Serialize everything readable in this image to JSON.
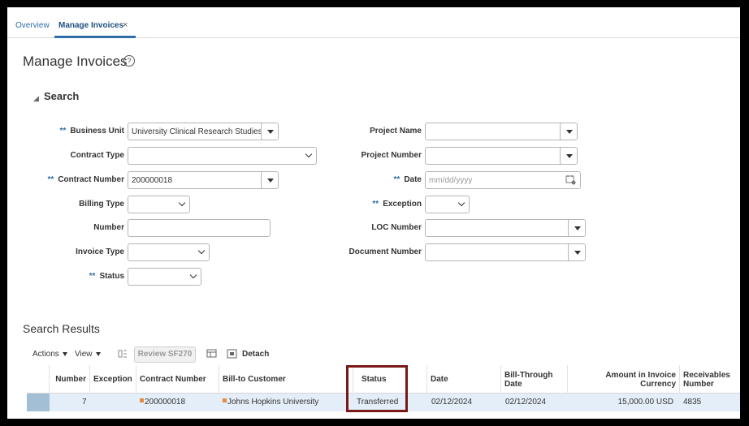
{
  "tabs": {
    "overview": "Overview",
    "manage": "Manage Invoices",
    "close": "×"
  },
  "page": {
    "title": "Manage Invoices",
    "help": "?"
  },
  "search": {
    "title": "Search",
    "required_marker": "**",
    "fields": {
      "business_unit": {
        "label": "Business Unit",
        "value": "University Clinical Research Studies"
      },
      "contract_type": {
        "label": "Contract Type",
        "value": ""
      },
      "contract_number": {
        "label": "Contract Number",
        "value": "200000018"
      },
      "billing_type": {
        "label": "Billing Type",
        "value": ""
      },
      "number": {
        "label": "Number",
        "value": ""
      },
      "invoice_type": {
        "label": "Invoice Type",
        "value": ""
      },
      "status": {
        "label": "Status",
        "value": ""
      },
      "project_name": {
        "label": "Project Name",
        "value": ""
      },
      "project_number": {
        "label": "Project Number",
        "value": ""
      },
      "date": {
        "label": "Date",
        "placeholder": "mm/dd/yyyy"
      },
      "exception": {
        "label": "Exception",
        "value": ""
      },
      "loc_number": {
        "label": "LOC Number",
        "value": ""
      },
      "document_number": {
        "label": "Document Number",
        "value": ""
      }
    }
  },
  "results": {
    "title": "Search Results",
    "toolbar": {
      "actions": "Actions",
      "view": "View",
      "review": "Review SF270",
      "detach": "Detach"
    },
    "columns": {
      "number": "Number",
      "exception": "Exception",
      "contract_number": "Contract Number",
      "bill_to_customer": "Bill-to Customer",
      "status": "Status",
      "date": "Date",
      "bill_through_line1": "Bill-Through",
      "bill_through_line2": "Date",
      "amount_line1": "Amount in Invoice",
      "amount_line2": "Currency",
      "receivables_line1": "Receivables",
      "receivables_line2": "Number"
    },
    "rows": [
      {
        "number": "7",
        "contract_number": "200000018",
        "bill_to_customer": "Johns Hopkins University",
        "status": "Transferred",
        "date": "02/12/2024",
        "bill_through_date": "02/12/2024",
        "amount": "15,000.00 USD",
        "receivables_number": "4835"
      }
    ]
  },
  "colors": {
    "accent": "#2f6ea8",
    "highlight": "#7a1818",
    "row_selected": "#e4eef8"
  }
}
